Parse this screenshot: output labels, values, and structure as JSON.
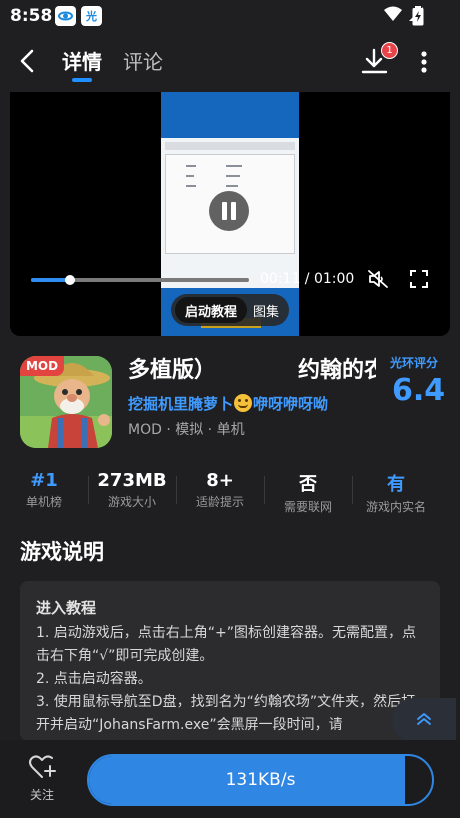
{
  "status_bar": {
    "time": "8:58",
    "app_icons": [
      "ie-icon",
      "guanghuan-icon"
    ],
    "app_icon_glyph": "光",
    "indicators": [
      "wifi-icon",
      "signal-icon",
      "battery-icon"
    ]
  },
  "header": {
    "tabs": [
      {
        "label": "详情",
        "active": true
      },
      {
        "label": "评论",
        "active": false
      }
    ],
    "download_badge": "1"
  },
  "player": {
    "current_time": "00:11",
    "duration": "01:00",
    "progress_percent": 18,
    "state": "playing",
    "tabs": [
      {
        "label": "启动教程",
        "active": true
      },
      {
        "label": "图集",
        "active": false
      }
    ]
  },
  "app": {
    "badge": "MOD",
    "title_left": "多植版）",
    "title_right": "约翰的农",
    "subtitle_before": "挖掘机里腌萝卜",
    "subtitle_after": "咿呀咿呀呦",
    "tags": "MOD · 模拟 · 单机",
    "score_label": "光环评分",
    "score": "6.4"
  },
  "stats": [
    {
      "value": "#1",
      "label": "单机榜",
      "highlight": true
    },
    {
      "value": "273MB",
      "label": "游戏大小",
      "highlight": false
    },
    {
      "value": "8+",
      "label": "适龄提示",
      "highlight": false
    },
    {
      "value": "否",
      "label": "需要联网",
      "highlight": false
    },
    {
      "value": "有",
      "label": "游戏内实名",
      "highlight": true
    }
  ],
  "description": {
    "section_title": "游戏说明",
    "heading": "进入教程",
    "lines": [
      "1. 启动游戏后，点击右上角“+”图标创建容器。无需配置，点击右下角“√”即可完成创建。",
      "2. 点击启动容器。",
      "3. 使用鼠标导航至D盘，找到名为“约翰农场”文件夹，然后打开并启动“JohansFarm.exe”会黑屏一段时间，请"
    ]
  },
  "bottom_bar": {
    "favorite_label": "关注",
    "download_speed": "131KB/s",
    "download_progress_percent": 92
  },
  "colors": {
    "accent": "#3f9bff",
    "background": "#1f1f21",
    "badge_red": "#e8444a"
  }
}
